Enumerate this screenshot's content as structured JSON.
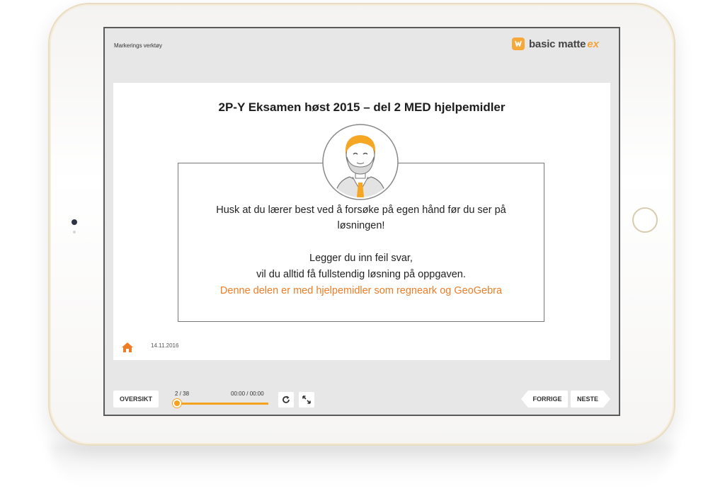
{
  "toolbar": {
    "tool_label": "Markerings verktøy",
    "brand_name": "basic matte",
    "brand_suffix": "ex",
    "brand_color": "#f4a33c"
  },
  "slide": {
    "title": "2P-Y Eksamen høst 2015 – del 2 MED hjelpemidler",
    "notice_lines": [
      "Husk at du lærer best ved å forsøke på egen hånd før du ser på",
      "løsningen!",
      "Legger du inn feil svar,",
      "vil du alltid få fullstendig løsning på oppgaven.",
      "Denne delen er med hjelpemidler som regneark og GeoGebra"
    ],
    "highlight_color": "#ef7d27",
    "date": "14.11.2016",
    "home_icon": "home-icon"
  },
  "controls": {
    "oversikt_label": "OVERSIKT",
    "slide_counter": "2 / 38",
    "time": "00:00 / 00:00",
    "progress_fraction": 0.026,
    "accent_color": "#f5a21e",
    "replay_icon": "replay-icon",
    "fullscreen_icon": "fullscreen-icon",
    "previous_label": "FORRIGE",
    "next_label": "NESTE"
  }
}
